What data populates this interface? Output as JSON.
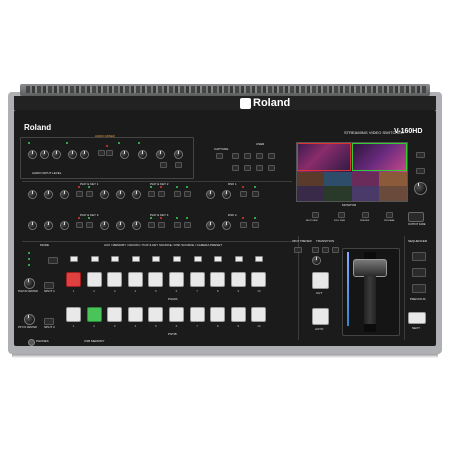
{
  "device": {
    "brand": "Roland",
    "model": "V-160HD",
    "subtitle": "STREAMING VIDEO SWITCHER",
    "colors": {
      "body": "#1d1d1d",
      "chassis": "#aeb0b3",
      "tally_red": "#e04040",
      "tally_green": "#49c458",
      "accent_orange": "#f0a53a"
    }
  },
  "sections": {
    "audio_mixer": "AUDIO MIXER",
    "audio_input_level": "AUDIO INPUT LEVEL",
    "user": "USER",
    "capture": "CAPTURE",
    "monitor": "MONITOR",
    "sequencer": "SEQUENCER",
    "pinp_key1": "PinP & KEY 1",
    "pinp_key2": "PinP & KEY 2",
    "pinp_key3": "PinP & KEY 3",
    "pinp_key4": "PinP & KEY 4",
    "dsk1": "DSK 1",
    "dsk2": "DSK 2",
    "aux_bar": "AUX / MEMORY / MACRO / PinP & KEY SOURCE / DSK SOURCE / CAMERA PRESET",
    "mode": "MODE",
    "transition": "TRANSITION",
    "input_preview": "INPUT PREVIEW",
    "pgm_a": "PGM/A",
    "pst_b": "PST/B",
    "split1": "SPLIT 1",
    "split2": "SPLIT 2",
    "pgm_center": "PGM IN CENTER",
    "pst_center": "PST IN CENTER",
    "phones": "PHONES",
    "usb_memory": "USB MEMORY",
    "output_fade": "OUTPUT FADE",
    "cut": "CUT",
    "auto": "AUTO",
    "next": "NEXT",
    "previous": "PREVIOUS",
    "menu": "MENU",
    "exit": "EXIT"
  },
  "monitor_buttons": [
    "MULTI-VIEW",
    "STILL VIEW",
    "PREVIEW",
    "PROGRAM"
  ],
  "bus_numbers": [
    "1",
    "2",
    "3",
    "4",
    "5",
    "6",
    "7",
    "8",
    "9",
    "10"
  ],
  "tally": {
    "pgm_active": 1,
    "pst_active": 2
  }
}
